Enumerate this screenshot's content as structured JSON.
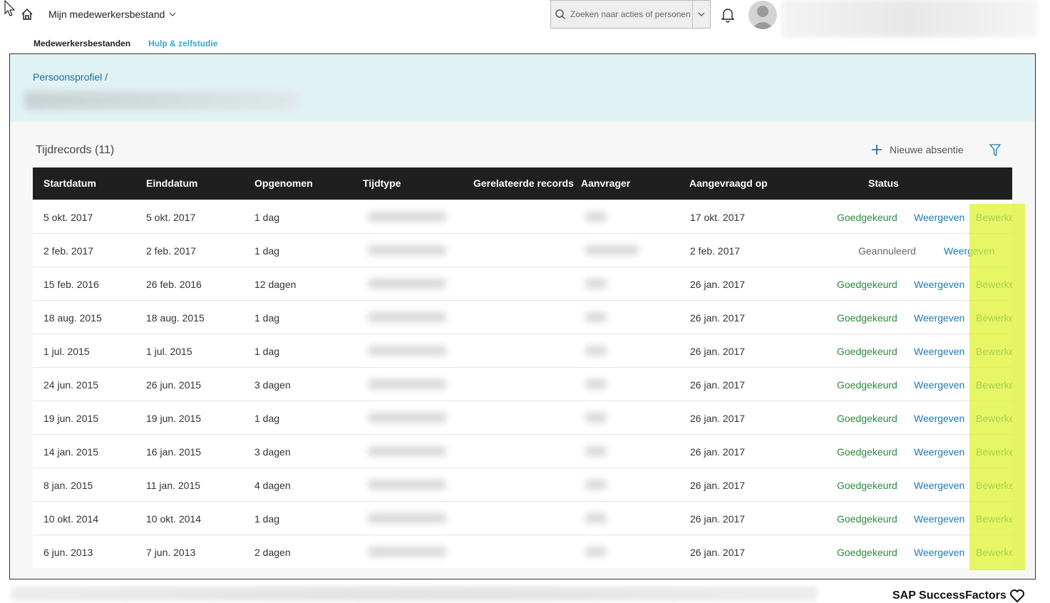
{
  "app_menu": {
    "label": "Mijn medewerkersbestand"
  },
  "search": {
    "placeholder": "Zoeken naar acties of personen"
  },
  "nav": {
    "active": "Medewerkersbestanden",
    "help": "Hulp & zelfstudie"
  },
  "breadcrumb": {
    "link": "Persoonsprofiel",
    "separator": "/"
  },
  "section": {
    "title": "Tijdrecords (11)",
    "new_absence": "Nieuwe absentie"
  },
  "table": {
    "headers": [
      "Startdatum",
      "Einddatum",
      "Opgenomen",
      "Tijdtype",
      "Gerelateerde records",
      "Aanvrager",
      "Aangevraagd op",
      "Status"
    ],
    "rows": [
      {
        "start": "5 okt. 2017",
        "end": "5 okt. 2017",
        "taken": "1 dag",
        "requested_on": "17 okt. 2017",
        "status": "Goedgekeurd",
        "view": "Weergeven",
        "edit": "Bewerken"
      },
      {
        "start": "2 feb. 2017",
        "end": "2 feb. 2017",
        "taken": "1 dag",
        "requested_on": "2 feb. 2017",
        "status": "Geannuleerd",
        "view": "Weergeven",
        "edit": ""
      },
      {
        "start": "15 feb. 2016",
        "end": "26 feb. 2016",
        "taken": "12 dagen",
        "requested_on": "26 jan. 2017",
        "status": "Goedgekeurd",
        "view": "Weergeven",
        "edit": "Bewerken"
      },
      {
        "start": "18 aug. 2015",
        "end": "18 aug. 2015",
        "taken": "1 dag",
        "requested_on": "26 jan. 2017",
        "status": "Goedgekeurd",
        "view": "Weergeven",
        "edit": "Bewerken"
      },
      {
        "start": "1 jul. 2015",
        "end": "1 jul. 2015",
        "taken": "1 dag",
        "requested_on": "26 jan. 2017",
        "status": "Goedgekeurd",
        "view": "Weergeven",
        "edit": "Bewerken"
      },
      {
        "start": "24 jun. 2015",
        "end": "26 jun. 2015",
        "taken": "3 dagen",
        "requested_on": "26 jan. 2017",
        "status": "Goedgekeurd",
        "view": "Weergeven",
        "edit": "Bewerken"
      },
      {
        "start": "19 jun. 2015",
        "end": "19 jun. 2015",
        "taken": "1 dag",
        "requested_on": "26 jan. 2017",
        "status": "Goedgekeurd",
        "view": "Weergeven",
        "edit": "Bewerken"
      },
      {
        "start": "14 jan. 2015",
        "end": "16 jan. 2015",
        "taken": "3 dagen",
        "requested_on": "26 jan. 2017",
        "status": "Goedgekeurd",
        "view": "Weergeven",
        "edit": "Bewerken"
      },
      {
        "start": "8 jan. 2015",
        "end": "11 jan. 2015",
        "taken": "4 dagen",
        "requested_on": "26 jan. 2017",
        "status": "Goedgekeurd",
        "view": "Weergeven",
        "edit": "Bewerken"
      },
      {
        "start": "10 okt. 2014",
        "end": "10 okt. 2014",
        "taken": "1 dag",
        "requested_on": "26 jan. 2017",
        "status": "Goedgekeurd",
        "view": "Weergeven",
        "edit": "Bewerken"
      },
      {
        "start": "6 jun. 2013",
        "end": "7 jun. 2013",
        "taken": "2 dagen",
        "requested_on": "26 jan. 2017",
        "status": "Goedgekeurd",
        "view": "Weergeven",
        "edit": "Bewerken"
      }
    ]
  },
  "footer": {
    "brand": "SAP SuccessFactors"
  },
  "colors": {
    "approved": "#2b8a3e",
    "link": "#1a7bb8",
    "header_band": "#e1f2f5",
    "highlight": "#dcf228"
  }
}
